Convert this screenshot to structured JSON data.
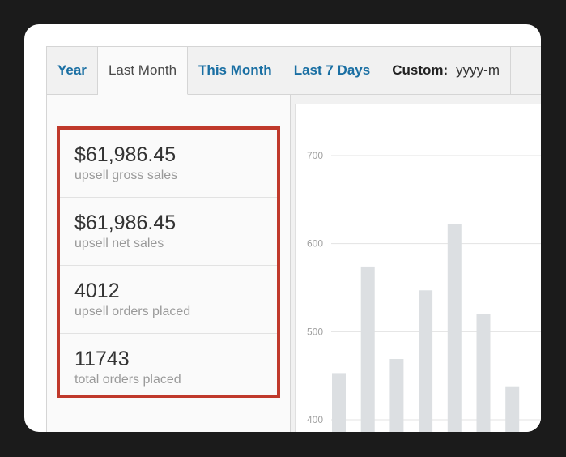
{
  "tabs": [
    {
      "label": "Year"
    },
    {
      "label": "Last Month"
    },
    {
      "label": "This Month"
    },
    {
      "label": "Last 7 Days"
    },
    {
      "label": "Custom:",
      "date_placeholder": "yyyy-m"
    }
  ],
  "active_tab": "Last Month",
  "stats": [
    {
      "value": "$61,986.45",
      "label": "upsell gross sales"
    },
    {
      "value": "$61,986.45",
      "label": "upsell net sales"
    },
    {
      "value": "4012",
      "label": "upsell orders placed"
    },
    {
      "value": "11743",
      "label": "total orders placed"
    }
  ],
  "colors": {
    "highlight": "#c0392b",
    "bar": "#dcdfe2",
    "tab_link": "#1a6fa3"
  },
  "chart_data": {
    "type": "bar",
    "y_ticks": [
      700,
      600,
      500,
      400
    ],
    "ylim": [
      380,
      720
    ],
    "values": [
      453,
      574,
      469,
      547,
      622,
      520,
      438
    ],
    "grid": true
  }
}
